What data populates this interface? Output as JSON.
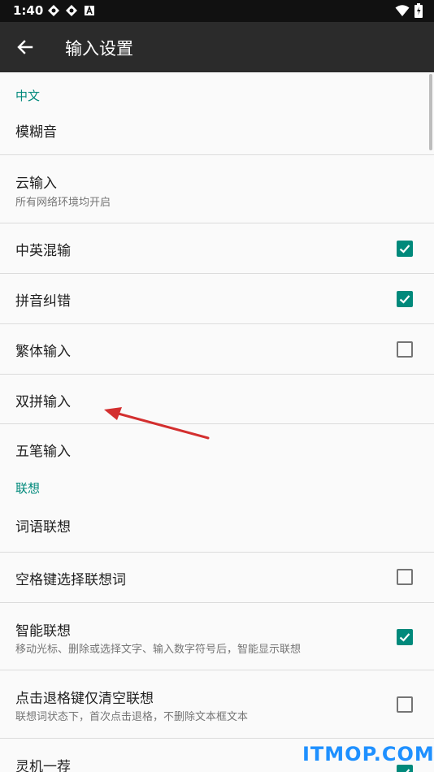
{
  "status_bar": {
    "time": "1:40"
  },
  "app_bar": {
    "title": "输入设置",
    "back_icon": "arrow-left-icon"
  },
  "sections": {
    "chinese": "中文",
    "association": "联想"
  },
  "rows": {
    "fuzzy": {
      "title": "模糊音"
    },
    "cloud": {
      "title": "云输入",
      "subtitle": "所有网络环境均开启"
    },
    "mixed": {
      "title": "中英混输",
      "checked": true
    },
    "pinyin_correct": {
      "title": "拼音纠错",
      "checked": true
    },
    "traditional": {
      "title": "繁体输入",
      "checked": false
    },
    "shuangpin": {
      "title": "双拼输入"
    },
    "wubi": {
      "title": "五笔输入"
    },
    "phrase_assoc": {
      "title": "词语联想"
    },
    "space_select": {
      "title": "空格键选择联想词",
      "checked": false
    },
    "smart_assoc": {
      "title": "智能联想",
      "subtitle": "移动光标、删除或选择文字、输入数字符号后，智能显示联想",
      "checked": true
    },
    "backspace_clear": {
      "title": "点击退格键仅清空联想",
      "subtitle": "联想词状态下，首次点击退格，不删除文本框文本",
      "checked": false
    },
    "lingji": {
      "title": "灵机一荐",
      "checked": true
    }
  },
  "watermark": "ITMOP.COM",
  "colors": {
    "accent": "#00897b",
    "appbar": "#2b2b2b",
    "arrow": "#d32f2f"
  }
}
